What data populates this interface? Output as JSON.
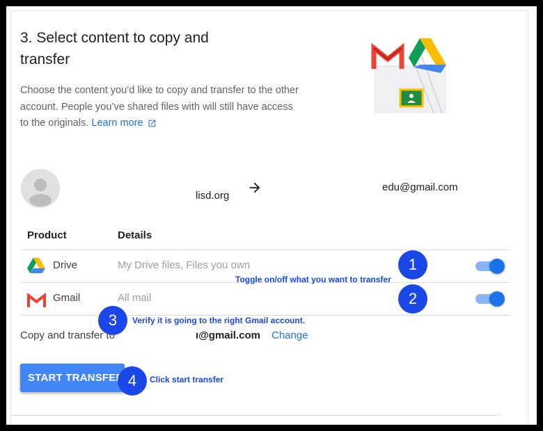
{
  "header": {
    "title": "3. Select content to copy and transfer",
    "description": "Choose the content you’d like to copy and transfer to the other account. People you’ve shared files with will still have access to the originals.",
    "learn_more": "Learn more"
  },
  "accounts": {
    "source": "lisd.org",
    "destination": "edu@gmail.com"
  },
  "table": {
    "col_product": "Product",
    "col_details": "Details",
    "rows": [
      {
        "name": "Drive",
        "details": "My Drive files, Files you own",
        "icon": "google-drive-icon",
        "enabled": true
      },
      {
        "name": "Gmail",
        "details": "All mail",
        "icon": "gmail-icon",
        "enabled": true
      }
    ]
  },
  "copy_to": {
    "label": "Copy and transfer to",
    "destination": "ı@gmail.com",
    "change_label": "Change"
  },
  "start_button": "START TRANSFER",
  "annotations": [
    {
      "number": "1",
      "text": "Toggle on/off what you want to transfer"
    },
    {
      "number": "2",
      "text": ""
    },
    {
      "number": "3",
      "text": "Verify it is going to the right Gmail account."
    },
    {
      "number": "4",
      "text": "Click start transfer"
    }
  ],
  "colors": {
    "accent": "#1a73e8",
    "button": "#4285f4",
    "callout": "#1a47e5",
    "toggle_track": "#8ab4f8"
  }
}
